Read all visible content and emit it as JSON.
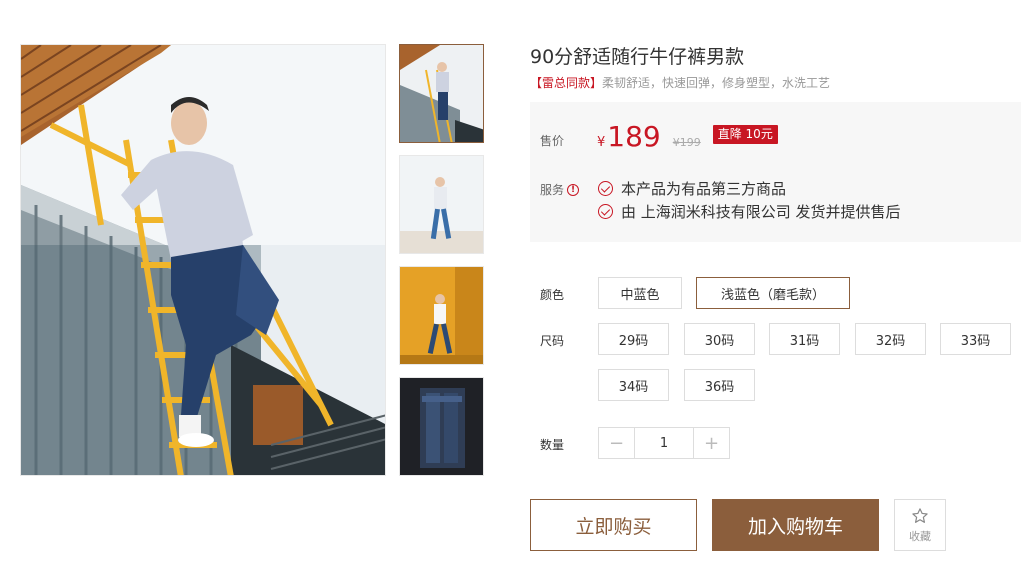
{
  "product": {
    "title": "90分舒适随行牛仔裤男款",
    "subtitle_tag": "【雷总同款】",
    "subtitle": "柔韧舒适，快速回弹，修身塑型，水洗工艺"
  },
  "price": {
    "label": "售价",
    "currency": "¥",
    "value": "189",
    "original": "¥199",
    "badge": "直降 10元"
  },
  "service": {
    "label": "服务",
    "info_icon": "!",
    "items": [
      "本产品为有品第三方商品",
      "由 上海润米科技有限公司 发货并提供售后"
    ]
  },
  "color": {
    "label": "颜色",
    "options": [
      "中蓝色",
      "浅蓝色（磨毛款）"
    ],
    "selected": "浅蓝色（磨毛款）"
  },
  "size": {
    "label": "尺码",
    "options": [
      "29码",
      "30码",
      "31码",
      "32码",
      "33码",
      "34码",
      "36码"
    ]
  },
  "quantity": {
    "label": "数量",
    "value": "1",
    "minus": "−",
    "plus": "+"
  },
  "actions": {
    "buy_now": "立即购买",
    "add_to_cart": "加入购物车",
    "favorite": "收藏"
  },
  "icons": {
    "check": "check-circle-icon",
    "favorite": "star-icon",
    "info": "info-icon"
  },
  "colors": {
    "accent": "#8b5e3c",
    "price_red": "#c81623"
  }
}
